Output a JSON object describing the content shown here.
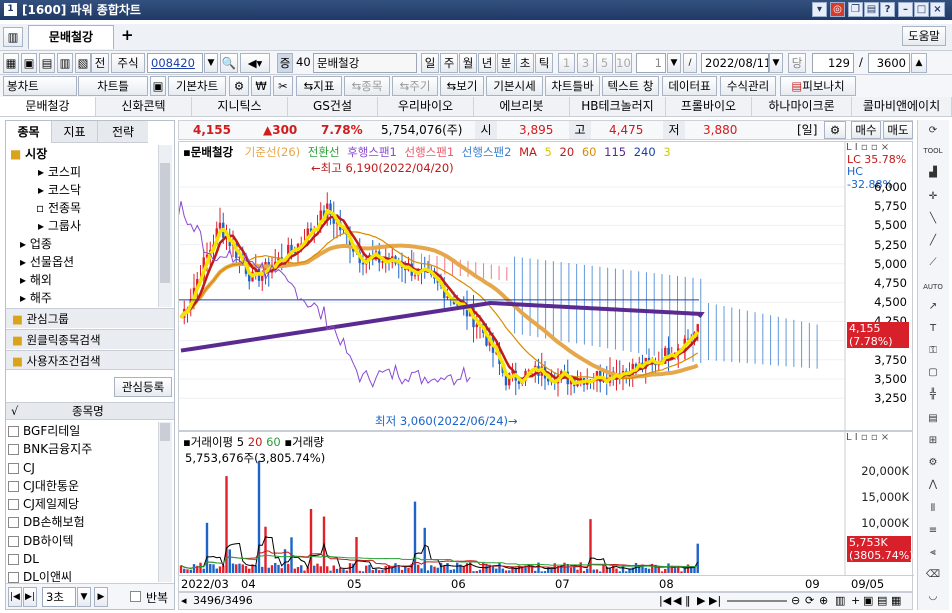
{
  "window": {
    "title": "[1600] 파워 종합차트",
    "id_badge": "1"
  },
  "toolbar1": {
    "tab_label": "문배철강",
    "add_tab": "+",
    "help_btn": "도움말",
    "btn_prev": "전",
    "market": "주식",
    "code": "008420",
    "code_tag": "증",
    "margin_rate": "40",
    "name": "문배철강",
    "periods": [
      "일",
      "주",
      "월",
      "년",
      "분",
      "초",
      "틱"
    ],
    "intervals": [
      "1",
      "3",
      "5",
      "10"
    ],
    "interval_value": "1",
    "date": "2022/08/11",
    "date_btn": "당",
    "count": "129",
    "slash": "/",
    "total": "3600"
  },
  "toolbar2": {
    "items": [
      "봉차트",
      "차트틀",
      "기본차트",
      "지표",
      "종목",
      "주기",
      "보기",
      "기본시세",
      "차트틀바",
      "텍스트 창",
      "데이터표",
      "수식관리",
      "피보나치"
    ]
  },
  "stock_tabs": [
    "문배철강",
    "신화콘텍",
    "지니틱스",
    "GS건설",
    "우리바이오",
    "에브리봇",
    "HB테크놀러지",
    "프롤바이오",
    "하나마이크론",
    "콜마비앤에이치"
  ],
  "side": {
    "tabs": [
      "종목",
      "지표",
      "전략"
    ],
    "market_label": "시장",
    "tree": [
      "코스피",
      "코스닥",
      "전종목",
      "그룹사",
      "업종",
      "선물옵션",
      "해외",
      "해주"
    ],
    "groups": [
      "관심그룹",
      "원클릭종목검색",
      "사용자조건검색"
    ],
    "register_btn": "관심등록",
    "list_header": "종목명",
    "list_check_header": "√",
    "list": [
      "BGF리테일",
      "BNK금융지주",
      "CJ",
      "CJ대한통운",
      "CJ제일제당",
      "DB손해보험",
      "DB하이텍",
      "DL",
      "DL이앤씨"
    ],
    "footer_interval": "3초",
    "footer_repeat": "반복"
  },
  "quote": {
    "price": "4,155",
    "change": "▲300",
    "rate": "7.78%",
    "volume": "5,754,076(주)",
    "open_label": "시",
    "open": "3,895",
    "high_label": "고",
    "high": "4,475",
    "low_label": "저",
    "low": "3,880",
    "period_tag": "[일]",
    "buy": "매수",
    "sell": "매도"
  },
  "chart": {
    "legend_name": "문배철강",
    "legend": [
      "기준선(26)",
      "전환선",
      "후행스팬1",
      "선행스팬1",
      "선행스팬2"
    ],
    "ma_label": "MA",
    "ma": [
      "5",
      "20",
      "60",
      "115",
      "240",
      "3"
    ],
    "lc": "LC  35.78%",
    "hc": "HC -32.88%",
    "yticks": [
      "6,000",
      "5,750",
      "5,500",
      "5,250",
      "5,000",
      "4,750",
      "4,500",
      "4,250",
      "4,000",
      "3,750",
      "3,500",
      "3,250"
    ],
    "price_tag": "4,155",
    "price_tag2": "(7.78%)",
    "high_note": "←최고 6,190(2022/04/20)",
    "low_note": "최저 3,060(2022/06/24)→",
    "colors": {
      "up": "#e0202a",
      "down": "#1c64c8",
      "ma5": "#f5e400",
      "ma20": "#c01a1a",
      "ma60": "#d98c00",
      "ma115": "#5a2a90",
      "base": "#e6a64a",
      "cloud_pos": "#e85a6a",
      "cloud_neg": "#3b7fcf"
    }
  },
  "volume": {
    "legend": "거래이평",
    "ma": [
      "5",
      "20",
      "60"
    ],
    "legend2": "거래량",
    "current": "5,753,676주(3,805.74%)",
    "yticks": [
      "20,000K",
      "15,000K",
      "10,000K"
    ],
    "tag": "5,753K",
    "tag2": "(3805.74%)",
    "xticks": [
      "2022/03",
      "04",
      "05",
      "06",
      "07",
      "08",
      "09"
    ],
    "x_end": "09/05"
  },
  "status": {
    "counter": "3496/3496"
  }
}
